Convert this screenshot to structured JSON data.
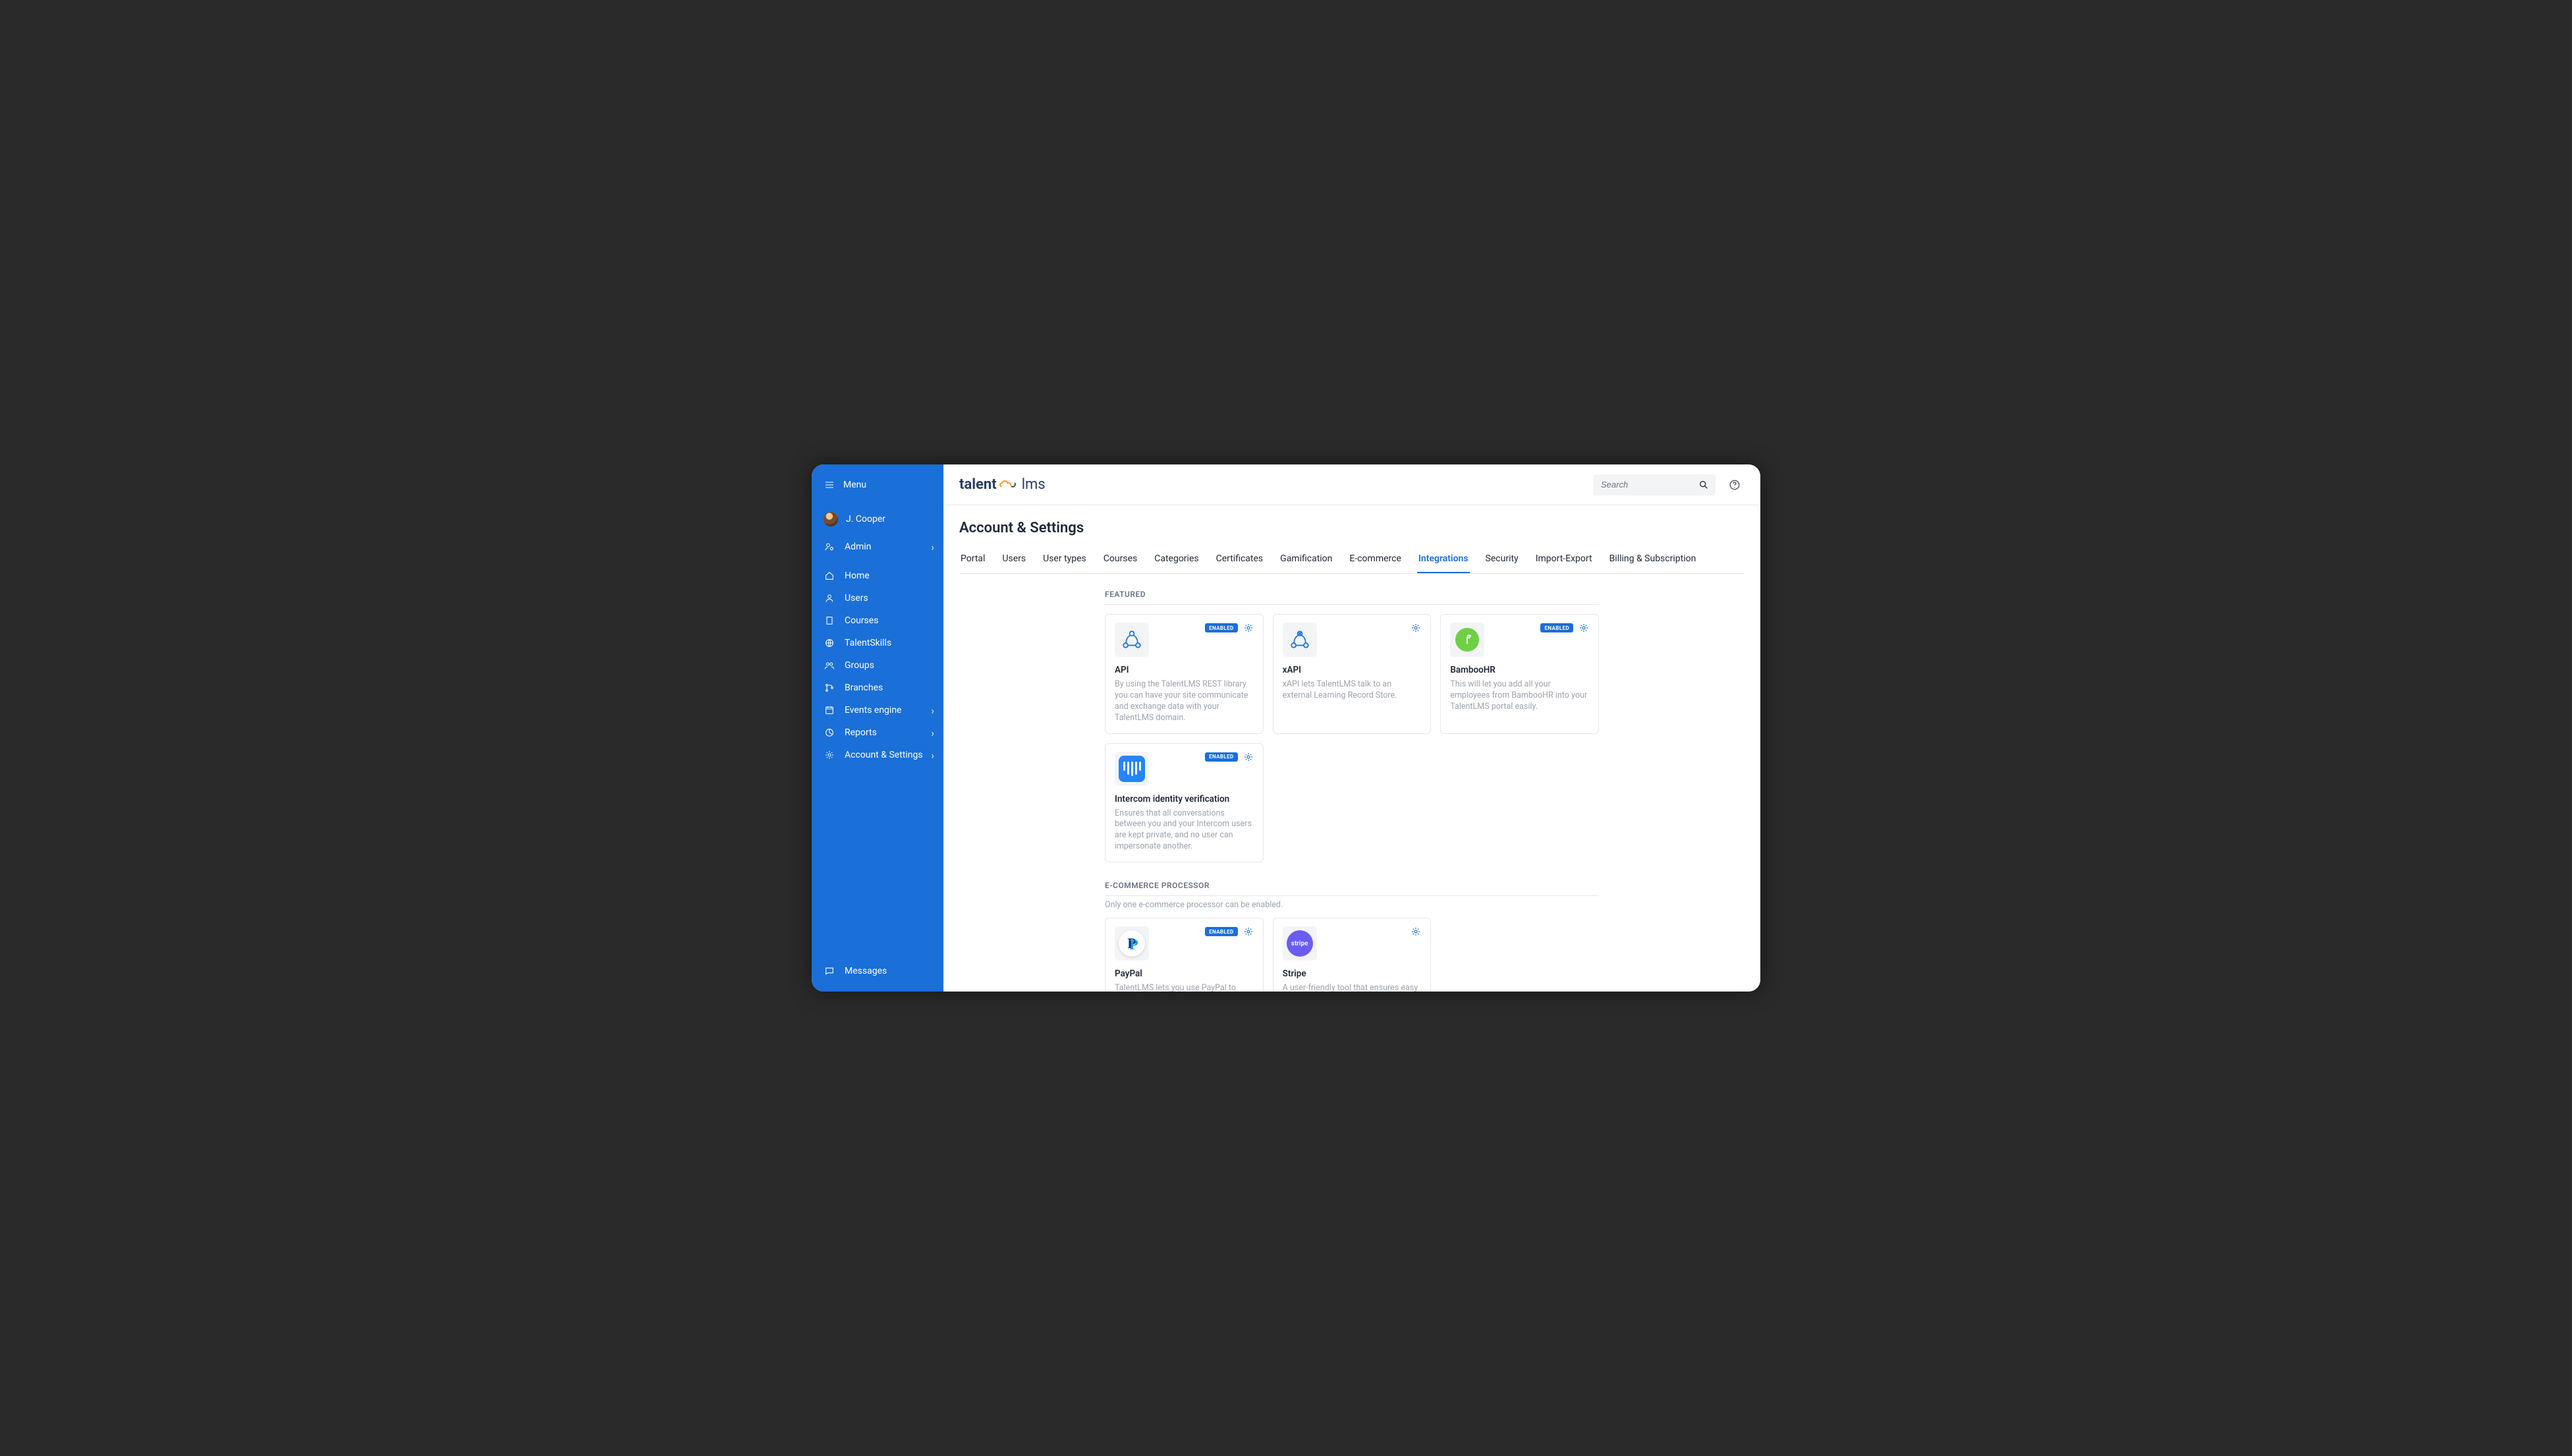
{
  "sidebar": {
    "menu_label": "Menu",
    "user_name": "J. Cooper",
    "items": [
      {
        "label": "Admin",
        "icon": "user-gear",
        "arrow": true
      },
      {
        "label": "Home",
        "icon": "home"
      },
      {
        "label": "Users",
        "icon": "user"
      },
      {
        "label": "Courses",
        "icon": "book"
      },
      {
        "label": "TalentSkills",
        "icon": "globe"
      },
      {
        "label": "Groups",
        "icon": "group"
      },
      {
        "label": "Branches",
        "icon": "branch"
      },
      {
        "label": "Events engine",
        "icon": "calendar",
        "arrow": true
      },
      {
        "label": "Reports",
        "icon": "chart",
        "arrow": true
      },
      {
        "label": "Account & Settings",
        "icon": "gear",
        "arrow": true
      }
    ],
    "footer": {
      "label": "Messages",
      "icon": "message"
    }
  },
  "topbar": {
    "logo": {
      "part1": "talent",
      "part2": "lms"
    },
    "search_placeholder": "Search"
  },
  "page": {
    "title": "Account & Settings",
    "tabs": [
      "Portal",
      "Users",
      "User types",
      "Courses",
      "Categories",
      "Certificates",
      "Gamification",
      "E-commerce",
      "Integrations",
      "Security",
      "Import-Export",
      "Billing & Subscription"
    ],
    "active_tab": "Integrations"
  },
  "sections": [
    {
      "label": "FEATURED",
      "cards": [
        {
          "id": "api",
          "title": "API",
          "desc": "By using the TalentLMS REST library you can have your site communicate and exchange data with your TalentLMS domain.",
          "enabled": true,
          "icon": "api"
        },
        {
          "id": "xapi",
          "title": "xAPI",
          "desc": "xAPI lets TalentLMS talk to an external Learning Record Store.",
          "enabled": false,
          "icon": "xapi"
        },
        {
          "id": "bamboohr",
          "title": "BambooHR",
          "desc": "This will let you add all your employees from BambooHR into your TalentLMS portal easily.",
          "enabled": true,
          "icon": "bamboo"
        },
        {
          "id": "intercom",
          "title": "Intercom identity verification",
          "desc": "Ensures that all conversations between you and your Intercom users are kept private, and no user can impersonate another.",
          "enabled": true,
          "icon": "intercom"
        }
      ]
    },
    {
      "label": "E-COMMERCE PROCESSOR",
      "note": "Only one e-commerce processor can be enabled.",
      "cards": [
        {
          "id": "paypal",
          "title": "PayPal",
          "desc": "TalentLMS lets you use PayPal to process your users' payments quickly and securely.",
          "enabled": true,
          "icon": "paypal"
        },
        {
          "id": "stripe",
          "title": "Stripe",
          "desc": "A user-friendly tool that ensures easy and secure transactions. It offers extensive reporting and issues refunds.",
          "enabled": false,
          "icon": "stripe"
        }
      ]
    }
  ],
  "labels": {
    "enabled_badge": "ENABLED"
  }
}
